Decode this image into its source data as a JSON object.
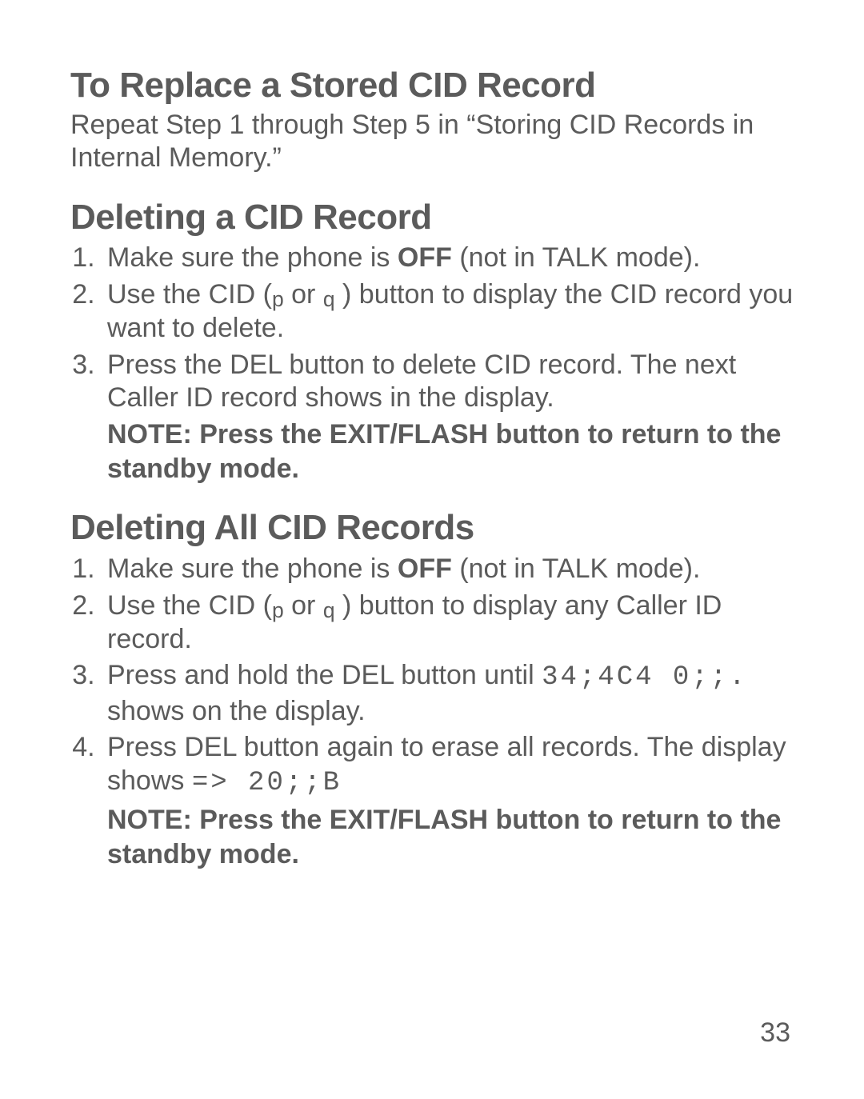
{
  "page_number": "33",
  "section1": {
    "heading": "To Replace a Stored CID Record",
    "para": "Repeat Step 1 through Step 5 in “Storing CID Records in Internal Memory.”"
  },
  "section2": {
    "heading": "Deleting a CID Record",
    "step1_pre": "Make sure the phone is ",
    "step1_bold": "OFF",
    "step1_post": " (not in TALK mode).",
    "step2_pre": "Use the  CID (",
    "step2_sub1": "p",
    "step2_mid": " or ",
    "step2_sub2": "q",
    "step2_post": " ) button to display the CID record you want to delete.",
    "step3": "Press the DEL button to delete CID record. The next Caller ID record shows in the display.",
    "note": "NOTE: Press the EXIT/FLASH button to return to the standby mode."
  },
  "section3": {
    "heading": "Deleting All CID Records",
    "step1_pre": "Make sure the phone is ",
    "step1_bold": "OFF",
    "step1_post": " (not in TALK mode).",
    "step2_pre": "Use the  CID (",
    "step2_sub1": "p",
    "step2_mid": " or ",
    "step2_sub2": "q",
    "step2_post": " ) button to display any Caller ID record.",
    "step3_pre": "Press and hold the DEL button until  ",
    "step3_mono": "34;4C4 0;;.",
    "step3_post": "  shows on the display.",
    "step4_pre": "Press DEL button again to erase all records. The display shows  ",
    "step4_mono": "=> 20;;B",
    "note": "NOTE: Press the EXIT/FLASH button to return to the standby mode."
  }
}
